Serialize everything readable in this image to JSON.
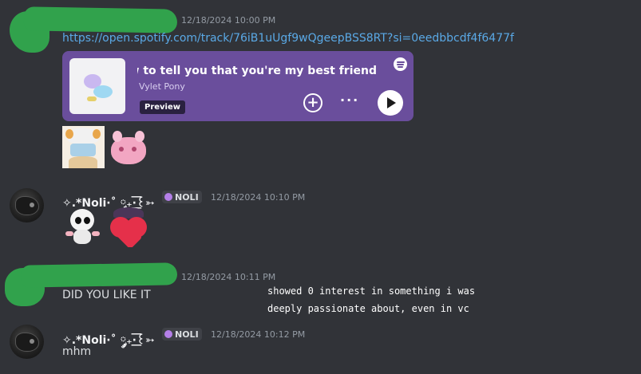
{
  "messages": [
    {
      "timestamp": "12/18/2024 10:00 PM",
      "link": "https://open.spotify.com/track/76iB1uUgf9wQgeepBSS8RT?si=0eedbbcdf4f6477f",
      "embed": {
        "title": "I don't know how to tell you that you're my best friend",
        "artist": "Vylet Pony",
        "preview_label": "Preview",
        "accent": "#6a4e9c",
        "icons": [
          "spotify-icon",
          "add-circle-icon",
          "more-dots-icon",
          "play-icon"
        ]
      },
      "emoji_stickers": [
        "anime-girl-sticker",
        "pink-creature-sticker"
      ]
    },
    {
      "username": "✧.*Noli·˚ ༘₊·͟͟͞͞꒰➳",
      "tag": "NOLI",
      "timestamp": "12/18/2024 10:10 PM",
      "emoji_stickers": [
        "white-skull-creature-sticker",
        "heart-hug-sticker"
      ]
    },
    {
      "timestamp": "12/18/2024 10:11 PM",
      "text": "DID YOU LIKE IT"
    },
    {
      "username": "✧.*Noli·˚ ༘₊·͟͟͞͞꒰➳",
      "tag": "NOLI",
      "timestamp": "12/18/2024 10:12 PM",
      "text": "mhm"
    }
  ],
  "overlay_caption": {
    "line1": "showed 0 interest in something i was",
    "line2": "deeply passionate about, even in vc"
  },
  "colors": {
    "background": "#313338",
    "link": "#5aa9e6",
    "redaction": "#31a24c",
    "tag_dot": "#b47fe8"
  }
}
